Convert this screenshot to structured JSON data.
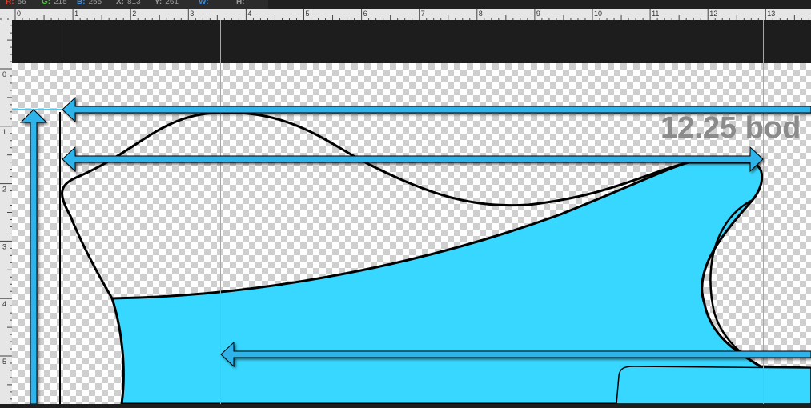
{
  "info_bar": {
    "r": {
      "key": "R:",
      "value": "56",
      "color": "#e0402a"
    },
    "g": {
      "key": "G:",
      "value": "215",
      "color": "#4cc23a"
    },
    "b": {
      "key": "B:",
      "value": "255",
      "color": "#3a8de0"
    },
    "x": {
      "key": "X:",
      "value": "813"
    },
    "y": {
      "key": "Y:",
      "value": "261"
    },
    "w": {
      "key": "W:",
      "value": ""
    },
    "h": {
      "key": "H:",
      "value": ""
    }
  },
  "ruler": {
    "horizontal_ticks": [
      "0",
      "1",
      "2",
      "3",
      "4",
      "5",
      "6",
      "7",
      "8",
      "9",
      "10",
      "11",
      "12",
      "13"
    ],
    "vertical_ticks": [
      "0",
      "1",
      "2",
      "3",
      "4",
      "5"
    ]
  },
  "canvas": {
    "dimension_label": "12.25 bod",
    "fill_color": "#38d7ff",
    "guide_color": "#4cc8ee",
    "arrow_color": "#2fb4ea"
  }
}
